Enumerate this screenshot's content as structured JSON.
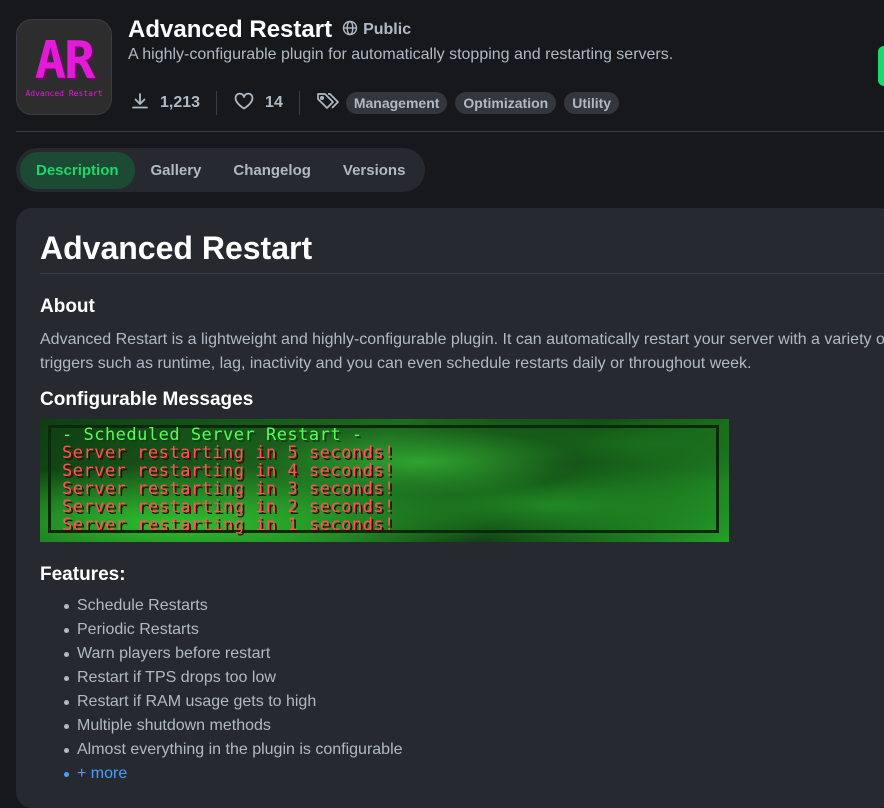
{
  "project": {
    "icon_big": "AR",
    "icon_small": "Advanced Restart",
    "title": "Advanced Restart",
    "visibility": "Public",
    "summary": "A highly-configurable plugin for automatically stopping and restarting servers.",
    "downloads": "1,213",
    "followers": "14",
    "tags": [
      "Management",
      "Optimization",
      "Utility"
    ]
  },
  "tabs": [
    "Description",
    "Gallery",
    "Changelog",
    "Versions"
  ],
  "active_tab": "Description",
  "content": {
    "heading": "Advanced Restart",
    "about_heading": "About",
    "about_text": "Advanced Restart is a lightweight and highly-configurable plugin. It can automatically restart your server with a variety of triggers such as runtime, lag, inactivity and you can even schedule restarts daily or throughout week.",
    "messages_heading": "Configurable Messages",
    "banner": {
      "title_line": " - Scheduled Server Restart -",
      "lines": [
        "Server restarting in 5 seconds!",
        "Server restarting in 4 seconds!",
        "Server restarting in 3 seconds!",
        "Server restarting in 2 seconds!",
        "Server restarting in 1 seconds!"
      ]
    },
    "features_heading": "Features:",
    "features": [
      "Schedule Restarts",
      "Periodic Restarts",
      "Warn players before restart",
      "Restart if TPS drops too low",
      "Restart if RAM usage gets to high",
      "Multiple shutdown methods",
      "Almost everything in the plugin is configurable"
    ],
    "more_link": "+ more"
  },
  "colors": {
    "accent": "#1bd96a",
    "link": "#4a9eff",
    "icon_magenta": "#e31bd9"
  }
}
